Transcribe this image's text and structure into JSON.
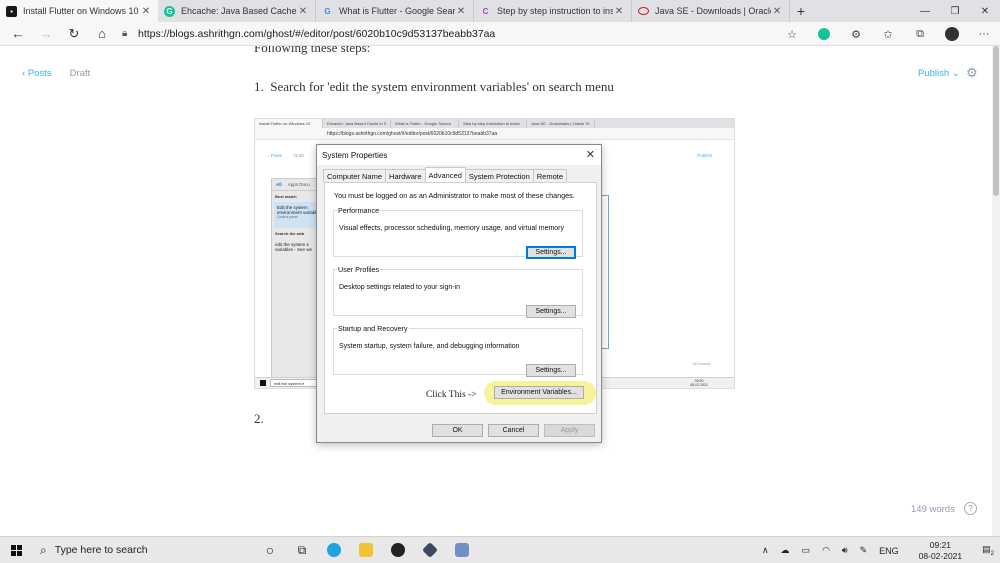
{
  "browser": {
    "tabs": [
      {
        "title": "Install Flutter on Windows 10 - A",
        "favicon": "ghost-icon",
        "active": true
      },
      {
        "title": "Ehcache: Java Based Cache in Sp",
        "favicon": "grammarly-icon",
        "active": false
      },
      {
        "title": "What is Flutter - Google Search",
        "favicon": "google-icon",
        "active": false
      },
      {
        "title": "Step by step instruction to instal",
        "favicon": "link-icon",
        "active": false
      },
      {
        "title": "Java SE - Downloads | Oracle Tec",
        "favicon": "oracle-icon",
        "active": false
      }
    ],
    "url": "https://blogs.ashrithgn.com/ghost/#/editor/post/6020b10c9d53137beabb37aa"
  },
  "editor": {
    "breadcrumb_posts": "Posts",
    "breadcrumb_draft": "Draft",
    "publish": "Publish",
    "pre_text": "Following these steps:",
    "step1_number": "1.",
    "step1_text": "Search for 'edit the system environment variables' on search menu",
    "step2_number": "2.",
    "word_count": "149 words",
    "help": "?"
  },
  "embedded_screenshot": {
    "tabs": [
      "Install Flutter on Windows 10",
      "Ehcache: Java Based Cache in S",
      "What is Flutter - Google Search",
      "Step by step instruction to instal",
      "Java SE - Downloads | Oracle Te"
    ],
    "url": "https://blogs.ashrithgn.com/ghost/#/editor/post/6020b10c9d53137beabb37aa",
    "posts": "Posts",
    "draft": "Draft",
    "publish": "Publish",
    "search_tabs": [
      "All",
      "Apps",
      "Docu"
    ],
    "best_match": "Best match",
    "best_match_item": "Edit the system environment variables",
    "best_match_sub": "Control panel",
    "search_web": "Search the web",
    "web_item": "edit the system e variables - See we",
    "search_box": "edit the system e",
    "words": "149 words",
    "time": "09:20",
    "date": "08-02-2021"
  },
  "dialog": {
    "title": "System Properties",
    "tabs": [
      "Computer Name",
      "Hardware",
      "Advanced",
      "System Protection",
      "Remote"
    ],
    "selected_tab": "Advanced",
    "admin_message": "You must be logged on as an Administrator to make most of these changes.",
    "performance_title": "Performance",
    "performance_desc": "Visual effects, processor scheduling, memory usage, and virtual memory",
    "profiles_title": "User Profiles",
    "profiles_desc": "Desktop settings related to your sign-in",
    "startup_title": "Startup and Recovery",
    "startup_desc": "System startup, system failure, and debugging information",
    "settings_label": "Settings...",
    "annotation": "Click This ->",
    "env_button": "Environment Variables...",
    "ok": "OK",
    "cancel": "Cancel",
    "apply": "Apply",
    "highlight_color": "#f6f39a"
  },
  "taskbar": {
    "search_placeholder": "Type here to search",
    "language": "ENG",
    "time": "09:21",
    "date": "08-02-2021",
    "notification_count": "2"
  }
}
